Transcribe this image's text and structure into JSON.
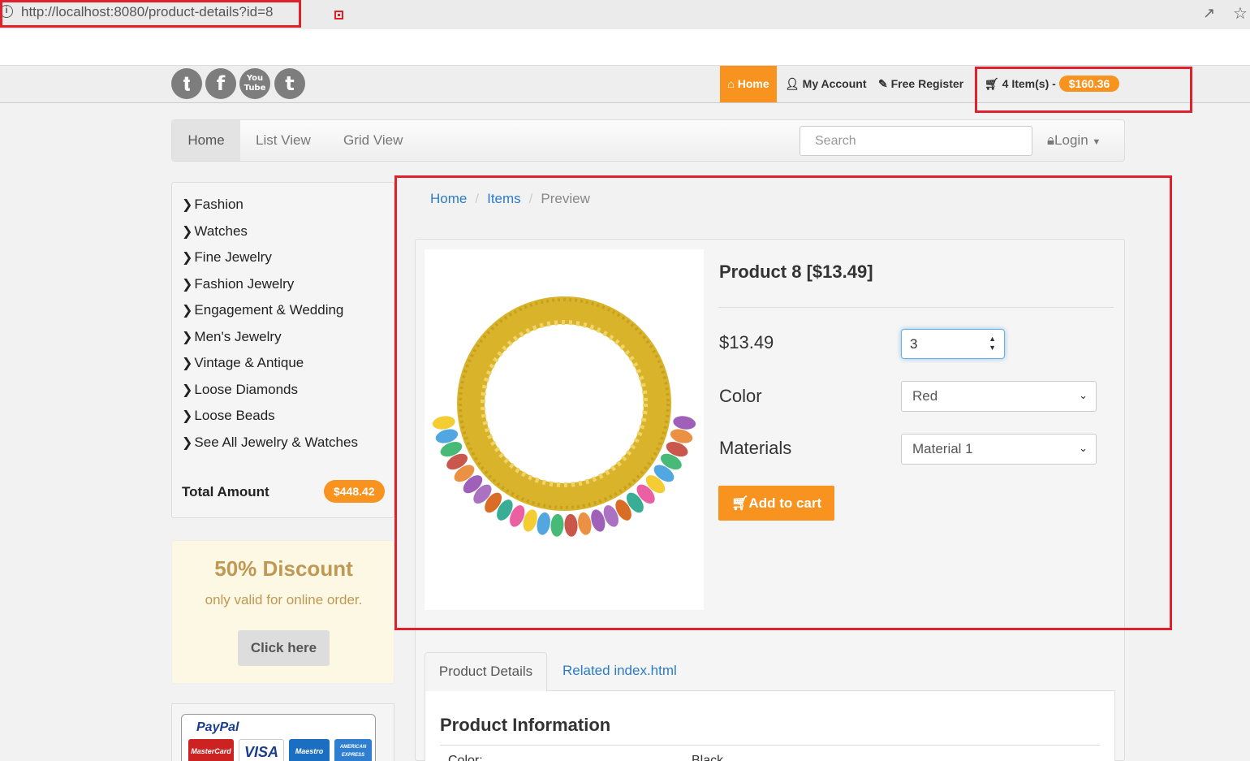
{
  "browser": {
    "url": "http://localhost:8080/product-details?id=8"
  },
  "social": [
    {
      "name": "twitter-icon",
      "glyph": "t"
    },
    {
      "name": "facebook-icon",
      "glyph": "f"
    },
    {
      "name": "youtube-icon",
      "glyph": "You Tube"
    },
    {
      "name": "tumblr-icon",
      "glyph": "t"
    }
  ],
  "topnav": {
    "home": "Home",
    "my_account": "My Account",
    "free_register": "Free Register",
    "cart_items": "4 Item(s) -",
    "cart_total": "$160.36"
  },
  "mainnav": {
    "home": "Home",
    "list_view": "List View",
    "grid_view": "Grid View",
    "search_placeholder": "Search",
    "login": "Login"
  },
  "sidebar": {
    "categories": [
      "Fashion",
      "Watches",
      "Fine Jewelry",
      "Fashion Jewelry",
      "Engagement & Wedding",
      "Men's Jewelry",
      "Vintage & Antique",
      "Loose Diamonds",
      "Loose Beads",
      "See All Jewelry & Watches"
    ],
    "total_label": "Total Amount",
    "total_amount": "$448.42",
    "discount_title": "50% Discount",
    "discount_sub": "only valid for online order.",
    "discount_button": "Click here",
    "paypal": "PayPal",
    "cards": [
      "MasterCard",
      "VISA",
      "Maestro",
      "AMERICAN EXPRESS"
    ]
  },
  "breadcrumb": {
    "home": "Home",
    "items": "Items",
    "current": "Preview"
  },
  "product": {
    "title": "Product 8 [$13.49]",
    "price": "$13.49",
    "quantity": "3",
    "color_label": "Color",
    "color_value": "Red",
    "materials_label": "Materials",
    "materials_value": "Material 1",
    "add_to_cart": "Add to cart"
  },
  "tabs": {
    "details": "Product Details",
    "related": "Related index.html"
  },
  "info": {
    "title": "Product Information",
    "rows": [
      {
        "key": "Color:",
        "value": "Black"
      }
    ]
  },
  "colors": {
    "accent": "#f7931e",
    "highlight": "#e0202a",
    "link": "#2a7cc7"
  }
}
